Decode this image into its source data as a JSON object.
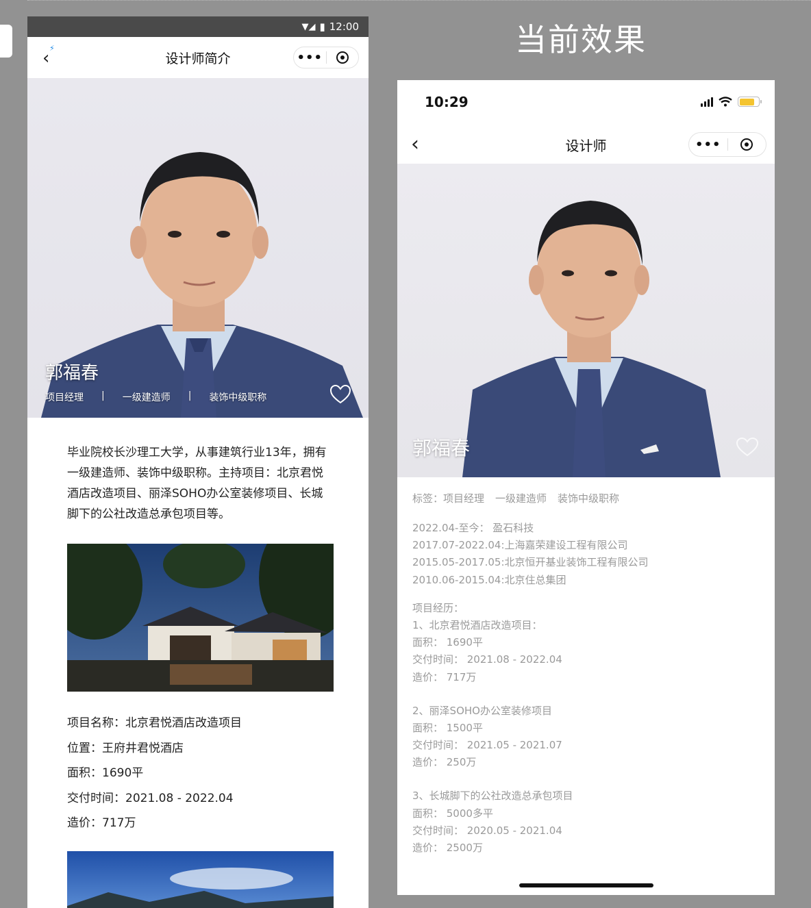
{
  "left_phone": {
    "status": {
      "time": "12:00"
    },
    "nav": {
      "title": "设计师简介"
    },
    "profile": {
      "name": "郭福春",
      "tags": [
        "项目经理",
        "一级建造师",
        "装饰中级职称"
      ]
    },
    "intro": "毕业院校长沙理工大学，从事建筑行业13年，拥有一级建造师、装饰中级职称。主持项目：北京君悦酒店改造项目、丽泽SOHO办公室装修项目、长城脚下的公社改造总承包项目等。",
    "project": {
      "name": "项目名称：北京君悦酒店改造项目",
      "location": "位置：王府井君悦酒店",
      "area": "面积：1690平",
      "delivery": "交付时间：2021.08 - 2022.04",
      "cost": "造价：717万"
    }
  },
  "right_phone": {
    "label": "当前效果",
    "status": {
      "time": "10:29"
    },
    "nav": {
      "title": "设计师"
    },
    "profile": {
      "name": "郭福春"
    },
    "tags_label": "标签：",
    "tags": [
      "项目经理",
      "一级建造师",
      "装饰中级职称"
    ],
    "history": [
      "2022.04-至今：  盈石科技",
      "2017.07-2022.04:上海嘉荣建设工程有限公司",
      "2015.05-2017.05:北京恒开基业装饰工程有限公司",
      "2010.06-2015.04:北京住总集团"
    ],
    "projects_header": "项目经历：",
    "projects": [
      {
        "title": "1、北京君悦酒店改造项目：",
        "area": "面积：  1690平",
        "delivery": "交付时间：  2021.08 - 2022.04",
        "cost": "造价：  717万"
      },
      {
        "title": "2、丽泽SOHO办公室装修项目",
        "area": "面积：  1500平",
        "delivery": "交付时间：  2021.05 - 2021.07",
        "cost": "造价：  250万"
      },
      {
        "title": "3、长城脚下的公社改造总承包项目",
        "area": "面积：  5000多平",
        "delivery": "交付时间：  2020.05 - 2021.04",
        "cost": "造价：  2500万"
      }
    ]
  }
}
